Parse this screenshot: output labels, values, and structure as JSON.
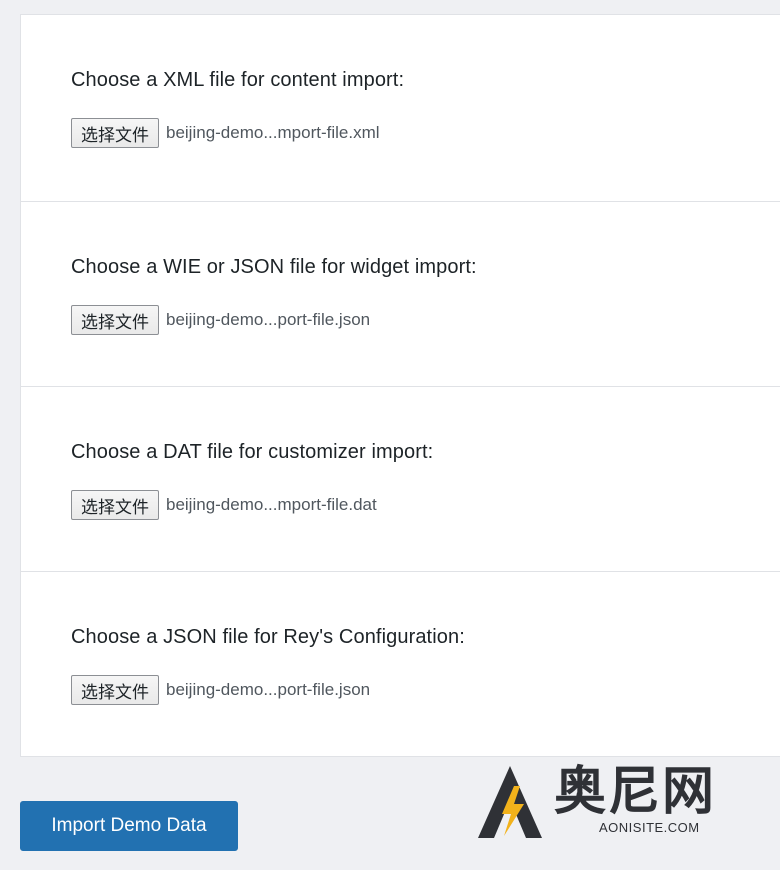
{
  "panels": [
    {
      "title": "Choose a XML file for content import:",
      "button_label": "选择文件",
      "file_name": "beijing-demo...mport-file.xml"
    },
    {
      "title": "Choose a WIE or JSON file for widget import:",
      "button_label": "选择文件",
      "file_name": "beijing-demo...port-file.json"
    },
    {
      "title": "Choose a DAT file for customizer import:",
      "button_label": "选择文件",
      "file_name": "beijing-demo...mport-file.dat"
    },
    {
      "title": "Choose a JSON file for Rey's Configuration:",
      "button_label": "选择文件",
      "file_name": "beijing-demo...port-file.json"
    }
  ],
  "import_button": {
    "label": "Import Demo Data"
  },
  "watermark": {
    "name_cn": "奥尼网",
    "domain": "AONISITE.COM",
    "logo_icon": "lightning-a-logo-icon"
  },
  "colors": {
    "primary": "#2271b1",
    "background": "#eff0f3",
    "panel": "#ffffff",
    "watermark_dark": "#2f3136",
    "watermark_accent": "#f2b21b"
  }
}
